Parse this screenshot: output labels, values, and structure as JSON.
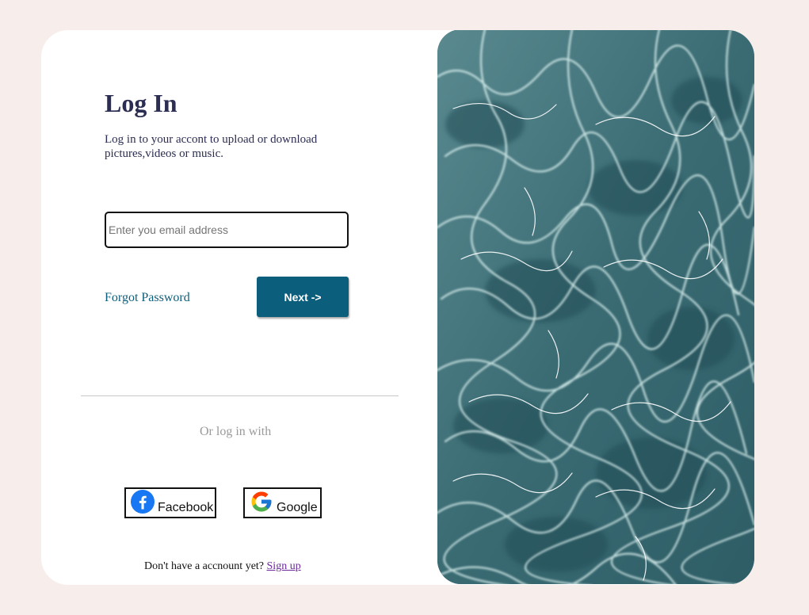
{
  "login": {
    "title": "Log In",
    "subtitle": "Log in to your accont to upload or download pictures,videos or music.",
    "email_placeholder": "Enter you email address",
    "email_value": "",
    "forgot_label": "Forgot Password",
    "next_label": "Next ->",
    "or_text": "Or log in with",
    "social": [
      {
        "label": "Facebook",
        "icon": "facebook-icon"
      },
      {
        "label": "Google",
        "icon": "google-icon"
      }
    ],
    "signup_prompt": "Don't have a accnount yet?",
    "signup_link": "Sign up"
  },
  "hero": {
    "image": "water-ripple-pool-image",
    "base_color": "#3d6f76"
  },
  "colors": {
    "page_background": "#f7eeec",
    "title": "#2b2d52",
    "accent": "#0b5e7c",
    "muted": "#9a9a9a",
    "link_visited": "#6a2a9a"
  }
}
